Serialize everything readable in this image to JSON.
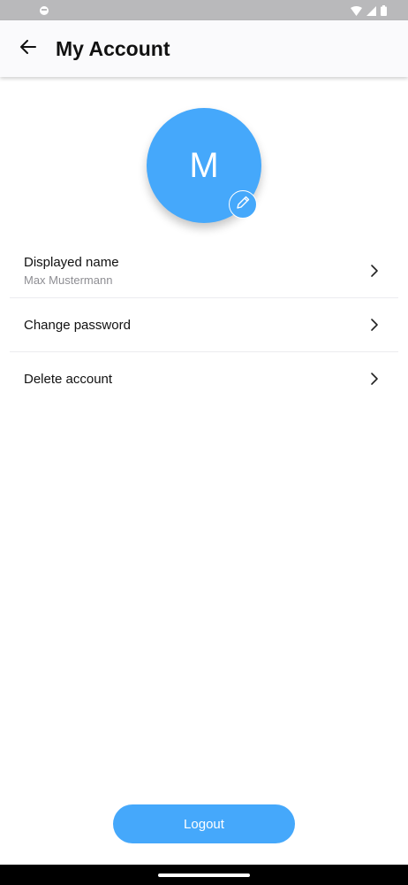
{
  "header": {
    "title": "My Account"
  },
  "avatar": {
    "initial": "M",
    "color": "#45a8fb"
  },
  "menu": {
    "items": [
      {
        "label": "Displayed name",
        "value": "Max Mustermann"
      },
      {
        "label": "Change password"
      },
      {
        "label": "Delete account"
      }
    ]
  },
  "footer": {
    "logout_label": "Logout"
  },
  "icons": {
    "back": "arrow-left-icon",
    "edit": "pencil-icon",
    "chevron": "chevron-right-icon"
  }
}
